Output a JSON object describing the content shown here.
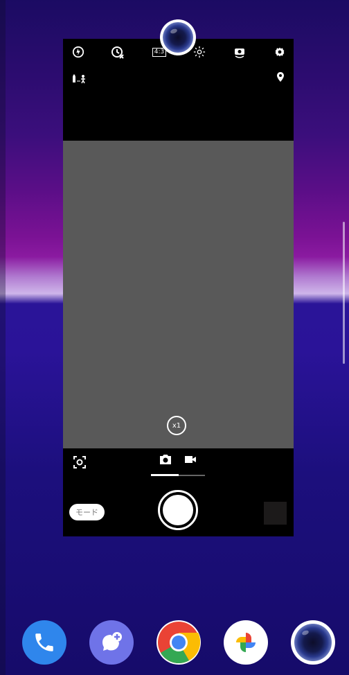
{
  "camera_app": {
    "top_icons": [
      "flash-auto-icon",
      "timer-off-icon",
      "aspect-ratio-icon",
      "brightness-icon",
      "switch-camera-icon",
      "settings-icon"
    ],
    "aspect_ratio_label": "4:3",
    "zoom_label": "x1",
    "mode_button_label": "モード",
    "tabs": [
      "photo-icon",
      "video-icon"
    ]
  },
  "dock": [
    "phone-icon",
    "messages-icon",
    "chrome-icon",
    "photos-icon",
    "camera-icon"
  ],
  "colors": {
    "viewfinder": "#595959",
    "shutter": "#ffffff",
    "wallpaper_top": "#1b0b63",
    "wallpaper_mid": "#8a1aa0",
    "wallpaper_bottom": "#160b6a"
  }
}
